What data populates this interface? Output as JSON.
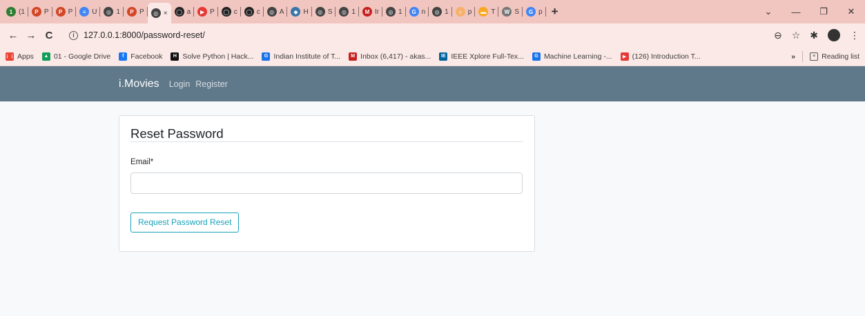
{
  "browser": {
    "tabs": [
      {
        "favicon": "1",
        "favicon_color": "#2e7d32",
        "label": "(1"
      },
      {
        "favicon": "P",
        "favicon_color": "#d24726",
        "label": "P"
      },
      {
        "favicon": "P",
        "favicon_color": "#d24726",
        "label": "P"
      },
      {
        "favicon": "≡",
        "favicon_color": "#4285f4",
        "label": "U"
      },
      {
        "favicon": "◎",
        "favicon_color": "#444444",
        "label": "1"
      },
      {
        "favicon": "P",
        "favicon_color": "#d24726",
        "label": "P"
      },
      {
        "favicon": "◎",
        "favicon_color": "#444444",
        "label": "×",
        "active": true
      },
      {
        "favicon": "◯",
        "favicon_color": "#222222",
        "label": "a"
      },
      {
        "favicon": "▶",
        "favicon_color": "#e53935",
        "label": "P"
      },
      {
        "favicon": "◯",
        "favicon_color": "#222222",
        "label": "c"
      },
      {
        "favicon": "◯",
        "favicon_color": "#222222",
        "label": "c"
      },
      {
        "favicon": "◎",
        "favicon_color": "#444444",
        "label": "A"
      },
      {
        "favicon": "◆",
        "favicon_color": "#3776ab",
        "label": "H"
      },
      {
        "favicon": "◎",
        "favicon_color": "#444444",
        "label": "S"
      },
      {
        "favicon": "◎",
        "favicon_color": "#444444",
        "label": "1"
      },
      {
        "favicon": "M",
        "favicon_color": "#c5221f",
        "label": "Ir"
      },
      {
        "favicon": "◎",
        "favicon_color": "#444444",
        "label": "1"
      },
      {
        "favicon": "G",
        "favicon_color": "#4285f4",
        "label": "n"
      },
      {
        "favicon": "◎",
        "favicon_color": "#444444",
        "label": "1"
      },
      {
        "favicon": "♪",
        "favicon_color": "#f6b26b",
        "label": "p"
      },
      {
        "favicon": "▬",
        "favicon_color": "#f9a825",
        "label": "T"
      },
      {
        "favicon": "W",
        "favicon_color": "#777777",
        "label": "S"
      },
      {
        "favicon": "G",
        "favicon_color": "#4285f4",
        "label": "p"
      }
    ],
    "new_tab": "+",
    "controls": {
      "dropdown": "⌄",
      "minimize": "—",
      "restore": "❐",
      "close": "✕"
    },
    "url": "127.0.0.1:8000/password-reset/",
    "nav": {
      "back": "←",
      "forward": "→",
      "reload": "C"
    },
    "toolbar_icons": {
      "zoom": "⊖",
      "star": "☆",
      "extensions": "✱"
    },
    "bookmarks": [
      {
        "icon": "⋮⋮",
        "color": "#ea4335",
        "label": "Apps"
      },
      {
        "icon": "▲",
        "color": "#0f9d58",
        "label": "01 - Google Drive"
      },
      {
        "icon": "f",
        "color": "#1877f2",
        "label": "Facebook"
      },
      {
        "icon": "H",
        "color": "#111111",
        "label": "Solve Python | Hack..."
      },
      {
        "icon": "G",
        "color": "#1a73e8",
        "label": "Indian Institute of T..."
      },
      {
        "icon": "M",
        "color": "#c5221f",
        "label": "Inbox (6,417) - akas..."
      },
      {
        "icon": "IE",
        "color": "#00629b",
        "label": "IEEE Xplore Full-Tex..."
      },
      {
        "icon": "G",
        "color": "#1a73e8",
        "label": "Machine Learning -..."
      },
      {
        "icon": "▶",
        "color": "#e53935",
        "label": "(126) Introduction T..."
      }
    ],
    "bookmarks_overflow": "»",
    "reading_list": "Reading list"
  },
  "site": {
    "brand": "i.Movies",
    "nav_links": [
      "Login",
      "Register"
    ]
  },
  "form": {
    "title": "Reset Password",
    "email_label": "Email*",
    "email_value": "",
    "submit_label": "Request Password Reset"
  }
}
